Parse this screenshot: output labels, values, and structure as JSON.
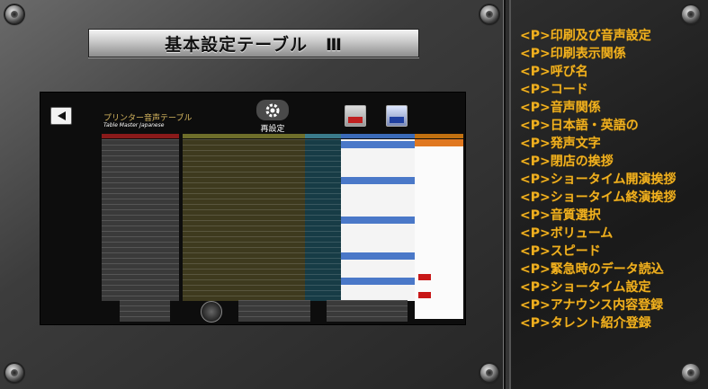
{
  "title": "基本設定テーブル　Ⅲ",
  "screen": {
    "title": "プリンター音声テーブル",
    "subtitle": "Table Master Japanese",
    "reset_label": "再設定"
  },
  "menu": [
    "<P>印刷及び音声設定",
    "<P>印刷表示関係",
    "<P>呼び名",
    "<P>コード",
    "<P>音声関係",
    "<P>日本語・英語の",
    "<P>発声文字",
    "<P>閉店の挨拶",
    "<P>ショータイム開演挨拶",
    "<P>ショータイム終演挨拶",
    "<P>音質選択",
    "<P>ボリューム",
    "<P>スピード",
    "<P>緊急時のデータ読込",
    "<P>ショータイム設定",
    "<P>アナウンス内容登録",
    "<P>タレント紹介登録"
  ]
}
